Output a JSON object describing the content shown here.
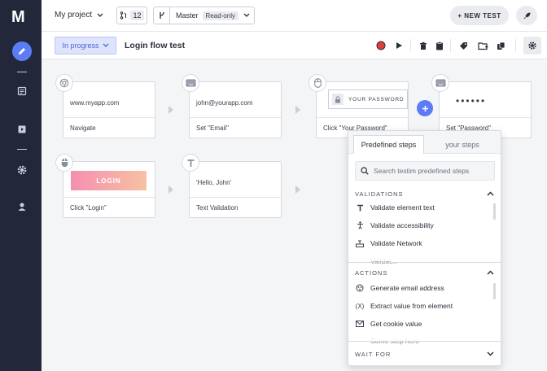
{
  "app": {
    "logo": "M"
  },
  "topbar": {
    "project": "My project",
    "branch_count": "12",
    "branch_name": "Master",
    "branch_badge": "Read-only",
    "new_test_label": "+ NEW TEST"
  },
  "testbar": {
    "status": "In progress",
    "test_name": "Login flow test"
  },
  "steps": {
    "navigate": {
      "content": "www.myapp.com",
      "label": "Navigate"
    },
    "email": {
      "content": "john@yourapp.com",
      "label": "Set \"Email\""
    },
    "password_click": {
      "content": "YOUR PASSWORD",
      "label": "Click \"Your Password\""
    },
    "password_set": {
      "content": "••••••",
      "label": "Set \"Password\""
    },
    "login": {
      "content": "LOGIN",
      "label": "Click \"Login\""
    },
    "text_validation": {
      "content": "'Hello, John'",
      "label": "Text Validation"
    }
  },
  "panel": {
    "tab_predefined": "Predefined steps",
    "tab_yours": "your steps",
    "search_placeholder": "Search testim predefined steps",
    "validations": {
      "title": "VALIDATIONS",
      "items": [
        "Validate element text",
        "Validate accessibility",
        "Validate Network",
        "Validat..."
      ]
    },
    "actions": {
      "title": "ACTIONS",
      "items": [
        "Generate email address",
        "Extract value from element",
        "Get cookie value",
        "Some step here"
      ]
    },
    "wait_for": {
      "title": "WAIT FOR"
    }
  },
  "colors": {
    "sidebar": "#22283a",
    "accent": "#5b7cf6",
    "record": "#e23b3b",
    "status_bg": "#dde4fb"
  }
}
